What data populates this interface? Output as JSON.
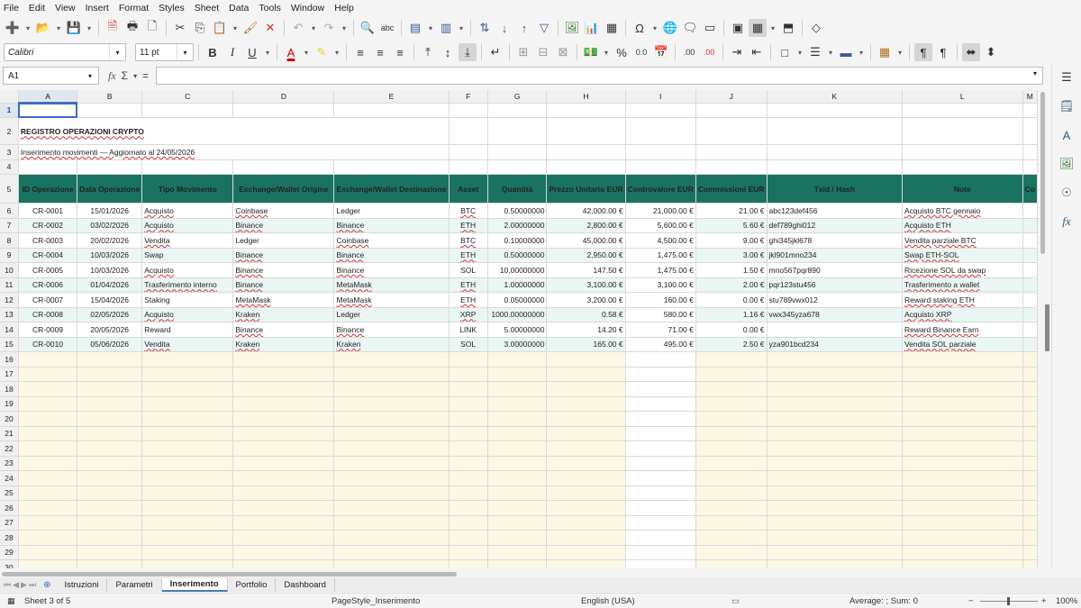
{
  "menu": [
    "File",
    "Edit",
    "View",
    "Insert",
    "Format",
    "Styles",
    "Sheet",
    "Data",
    "Tools",
    "Window",
    "Help"
  ],
  "toolbar": {
    "font_name": "Calibri",
    "font_size": "11 pt",
    "bold": "B",
    "italic": "I",
    "underline": "U",
    "percent": "%",
    "decimal": "0.0",
    "add_decimal": ".00",
    "del_decimal": ".00"
  },
  "formula_bar": {
    "cell_ref": "A1",
    "fx": "fx",
    "sum": "Σ",
    "equals": "=",
    "content": ""
  },
  "columns": [
    "A",
    "B",
    "C",
    "D",
    "E",
    "F",
    "G",
    "H",
    "I",
    "J",
    "K",
    "L",
    "M"
  ],
  "sheet": {
    "title": "REGISTRO OPERAZIONI CRYPTO",
    "subtitle": "Inserimento movimenti — Aggiornato al 24/05/2026",
    "headers": [
      "ID Operazione",
      "Data Operazione",
      "Tipo Movimento",
      "Exchange/Wallet Origine",
      "Exchange/Wallet Destinazione",
      "Asset",
      "Quantità",
      "Prezzo Unitario EUR",
      "Controvalore EUR",
      "Commissioni EUR",
      "Txid / Hash",
      "Note",
      "Co"
    ],
    "rows": [
      [
        "CR-0001",
        "15/01/2026",
        "Acquisto",
        "Coinbase",
        "Ledger",
        "BTC",
        "0.50000000",
        "42,000.00 €",
        "21,000.00 €",
        "21.00 €",
        "abc123def456",
        "Acquisto BTC gennaio"
      ],
      [
        "CR-0002",
        "03/02/2026",
        "Acquisto",
        "Binance",
        "Binance",
        "ETH",
        "2.00000000",
        "2,800.00 €",
        "5,600.00 €",
        "5.60 €",
        "def789ghi012",
        "Acquisto ETH"
      ],
      [
        "CR-0003",
        "20/02/2026",
        "Vendita",
        "Ledger",
        "Coinbase",
        "BTC",
        "0.10000000",
        "45,000.00 €",
        "4,500.00 €",
        "9.00 €",
        "ghi345jkl678",
        "Vendita parziale BTC"
      ],
      [
        "CR-0004",
        "10/03/2026",
        "Swap",
        "Binance",
        "Binance",
        "ETH",
        "0.50000000",
        "2,950.00 €",
        "1,475.00 €",
        "3.00 €",
        "jkl901mno234",
        "Swap ETH-SOL"
      ],
      [
        "CR-0005",
        "10/03/2026",
        "Acquisto",
        "Binance",
        "Binance",
        "SOL",
        "10.00000000",
        "147.50 €",
        "1,475.00 €",
        "1.50 €",
        "mno567pqr890",
        "Ricezione SOL da swap"
      ],
      [
        "CR-0006",
        "01/04/2026",
        "Trasferimento interno",
        "Binance",
        "MetaMask",
        "ETH",
        "1.00000000",
        "3,100.00 €",
        "3,100.00 €",
        "2.00 €",
        "pqr123stu456",
        "Trasferimento a wallet"
      ],
      [
        "CR-0007",
        "15/04/2026",
        "Staking",
        "MetaMask",
        "MetaMask",
        "ETH",
        "0.05000000",
        "3,200.00 €",
        "160.00 €",
        "0.00 €",
        "stu789vwx012",
        "Reward staking ETH"
      ],
      [
        "CR-0008",
        "02/05/2026",
        "Acquisto",
        "Kraken",
        "Ledger",
        "XRP",
        "1000.00000000",
        "0.58 €",
        "580.00 €",
        "1.16 €",
        "vwx345yza678",
        "Acquisto XRP"
      ],
      [
        "CR-0009",
        "20/05/2026",
        "Reward",
        "Binance",
        "Binance",
        "LINK",
        "5.00000000",
        "14.20 €",
        "71.00 €",
        "0.00 €",
        "",
        "Reward Binance Earn"
      ],
      [
        "CR-0010",
        "05/06/2026",
        "Vendita",
        "Kraken",
        "Kraken",
        "SOL",
        "3.00000000",
        "165.00 €",
        "495.00 €",
        "2.50 €",
        "yza901bcd234",
        "Vendita SOL parziale"
      ]
    ],
    "row_numbers": [
      "1",
      "2",
      "3",
      "4",
      "5",
      "6",
      "7",
      "8",
      "9",
      "10",
      "11",
      "12",
      "13",
      "14",
      "15",
      "16",
      "17",
      "18",
      "19",
      "20",
      "21",
      "22",
      "23",
      "24",
      "25",
      "26",
      "27",
      "28",
      "29",
      "30"
    ]
  },
  "tabs": [
    "Istruzioni",
    "Parametri",
    "Inserimento",
    "Portfolio",
    "Dashboard"
  ],
  "active_tab": "Inserimento",
  "status": {
    "sheet": "Sheet 3 of 5",
    "page_style": "PageStyle_Inserimento",
    "language": "English (USA)",
    "summary": "Average: ; Sum: 0",
    "zoom": "100%"
  },
  "colors": {
    "header_bg": "#1a7361",
    "band_even": "#eaf6f3",
    "empty_fill": "#fdf8e4",
    "accent": "#3a6cc4"
  }
}
